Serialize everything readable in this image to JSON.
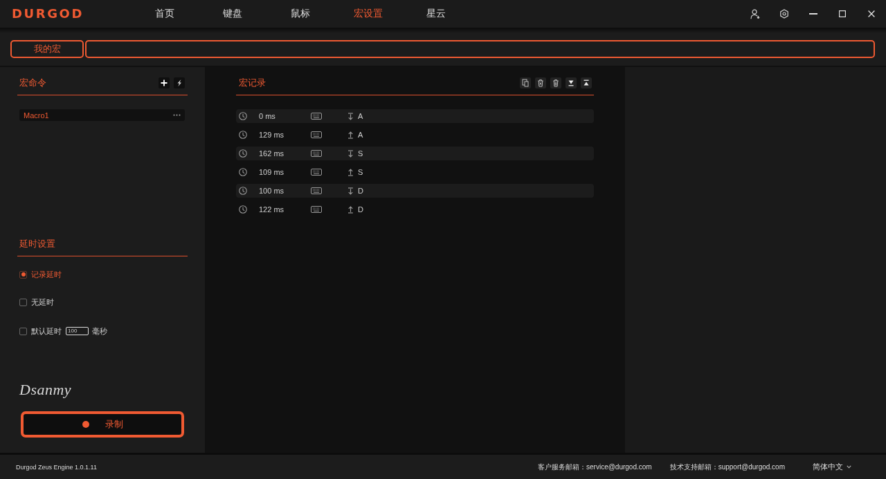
{
  "app_bar": {
    "logo": "DURGOD",
    "nav": [
      {
        "label": "首页",
        "selected": false
      },
      {
        "label": "键盘",
        "selected": false
      },
      {
        "label": "鼠标",
        "selected": false
      },
      {
        "label": "宏设置",
        "selected": true
      },
      {
        "label": "星云",
        "selected": false
      }
    ]
  },
  "sub_bar": {
    "tabs": [
      {
        "label": "我的宏",
        "selected": true
      }
    ]
  },
  "macro_commands": {
    "title": "宏命令",
    "items": [
      {
        "label": "Macro1",
        "selected": true
      }
    ]
  },
  "delay_settings": {
    "title": "延时设置",
    "options": [
      {
        "kind": "plain",
        "label": "记录延时",
        "selected": true
      },
      {
        "kind": "plain",
        "label": "无延时",
        "selected": false
      },
      {
        "kind": "input",
        "label": "默认延时",
        "value": "100",
        "unit": "毫秒",
        "selected": false
      }
    ]
  },
  "signature": "Dsanmy",
  "record_button": {
    "label": "录制"
  },
  "macro_record": {
    "title": "宏记录",
    "rows": [
      {
        "delay": "0 ms",
        "kind": "press",
        "key": "A"
      },
      {
        "delay": "129 ms",
        "kind": "release",
        "key": "A"
      },
      {
        "delay": "162 ms",
        "kind": "press",
        "key": "S"
      },
      {
        "delay": "109 ms",
        "kind": "release",
        "key": "S"
      },
      {
        "delay": "100 ms",
        "kind": "press",
        "key": "D"
      },
      {
        "delay": "122 ms",
        "kind": "release",
        "key": "D"
      }
    ]
  },
  "status_bar": {
    "version": "Durgod Zeus Engine 1.0.1.11",
    "service_email": "客户服务邮箱：service@durgod.com",
    "support_email": "技术支持邮箱：support@durgod.com",
    "language": "简体中文"
  }
}
